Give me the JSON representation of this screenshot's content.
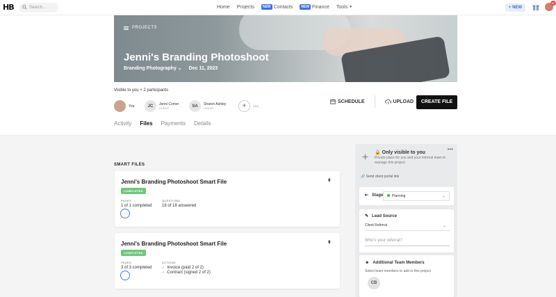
{
  "nav": {
    "logo": "HB",
    "search_placeholder": "Search...",
    "links": [
      {
        "label": "Home",
        "badge": ""
      },
      {
        "label": "Projects",
        "badge": ""
      },
      {
        "label": "Contacts",
        "badge": "NEW"
      },
      {
        "label": "Finance",
        "badge": "NEW"
      },
      {
        "label": "Tools",
        "badge": ""
      }
    ],
    "new_button": "+ NEW",
    "notification_count": "27"
  },
  "hero": {
    "breadcrumb": "PROJECTS",
    "title": "Jenni's Branding Photoshoot",
    "project_type": "Branding Photography",
    "date": "Dec 11, 2023"
  },
  "participants": {
    "visible_text": "Visible to you + 2 participants",
    "people": [
      {
        "initials": "",
        "name": "You",
        "role": ""
      },
      {
        "initials": "JC",
        "name": "Jenni Comer",
        "role": "CLIENT"
      },
      {
        "initials": "SA",
        "name": "Sharon Ashley",
        "role": "CLIENT"
      }
    ],
    "add_label": "ADD"
  },
  "actions": {
    "schedule": "SCHEDULE",
    "upload": "UPLOAD",
    "create_file": "CREATE FILE"
  },
  "tabs": [
    {
      "label": "Activity",
      "active": false
    },
    {
      "label": "Files",
      "active": true
    },
    {
      "label": "Payments",
      "active": false
    },
    {
      "label": "Details",
      "active": false
    }
  ],
  "smart_files": {
    "heading": "SMART FILES",
    "cards": [
      {
        "title": "Jenni's Branding Photoshoot Smart File",
        "status": "COMPLETED",
        "pages_label": "PAGES",
        "pages_value": "1 of 1 completed",
        "second_label": "QUESTIONS",
        "second_value": "18 of 18 answered"
      },
      {
        "title": "Jenni's Branding Photoshoot Smart File",
        "status": "COMPLETED",
        "pages_label": "PAGES",
        "pages_value": "3 of 3 completed",
        "second_label": "ACTIONS",
        "action_1": "Invoice (paid 2 of 2)",
        "action_2": "Contract (signed 2 of 2)"
      }
    ]
  },
  "side_panel": {
    "private_title": "Only visible to you",
    "private_desc": "Private place for you and your internal team to manage this project.",
    "portal_link": "Send client portal link",
    "stage_label": "Stage",
    "stage_value": "Planning",
    "lead_label": "Lead Source",
    "lead_value": "Client Referral",
    "referral_placeholder": "Who's your referral?",
    "team_label": "Additional Team Members",
    "team_desc": "Select team members to add to this project",
    "team_initials": "CB"
  }
}
